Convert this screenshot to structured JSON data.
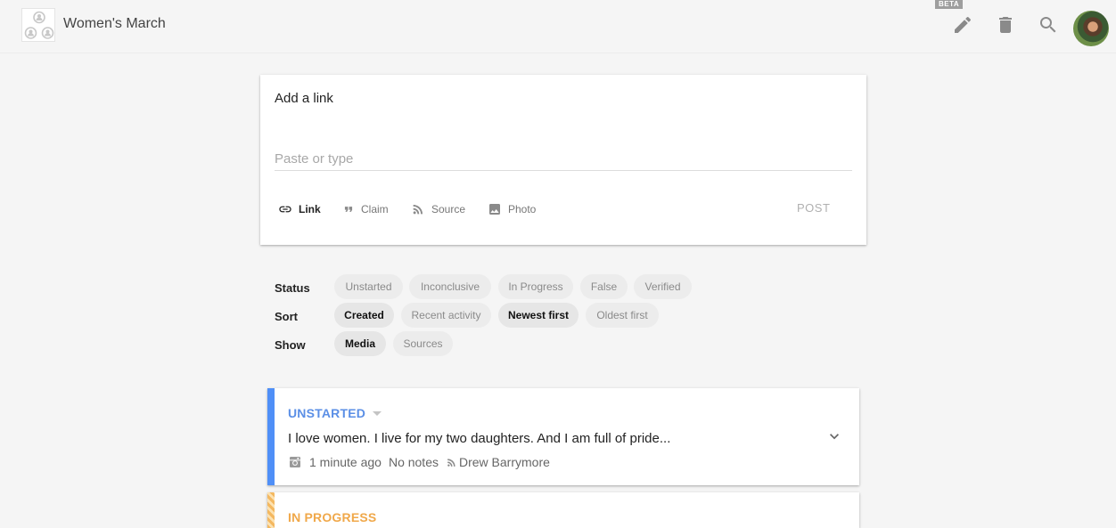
{
  "header": {
    "team_name": "Women's March",
    "beta_label": "BETA",
    "icons": [
      "pencil-icon",
      "trash-icon",
      "search-icon"
    ]
  },
  "add_link": {
    "title": "Add a link",
    "placeholder": "Paste or type",
    "value": "",
    "tools": [
      {
        "label": "Link",
        "icon": "link-icon",
        "active": true
      },
      {
        "label": "Claim",
        "icon": "quote-icon",
        "active": false
      },
      {
        "label": "Source",
        "icon": "rss-icon",
        "active": false
      },
      {
        "label": "Photo",
        "icon": "image-icon",
        "active": false
      }
    ],
    "post_label": "POST"
  },
  "filters": {
    "status": {
      "label": "Status",
      "options": [
        "Unstarted",
        "Inconclusive",
        "In Progress",
        "False",
        "Verified"
      ],
      "selected": []
    },
    "sort": {
      "label": "Sort",
      "options": [
        "Created",
        "Recent activity",
        "Newest first",
        "Oldest first"
      ],
      "selected": [
        "Created",
        "Newest first"
      ]
    },
    "show": {
      "label": "Show",
      "options": [
        "Media",
        "Sources"
      ],
      "selected": [
        "Media"
      ]
    }
  },
  "media": [
    {
      "status": "UNSTARTED",
      "status_color": "#5b8fe6",
      "title": "I love women. I live for my two daughters. And I am full of pride...",
      "time": "1 minute ago",
      "notes": "No notes",
      "source": "Drew Barrymore",
      "type_icon": "instagram-icon"
    },
    {
      "status": "IN PROGRESS",
      "status_color": "#f0a84a"
    }
  ],
  "colors": {
    "accent_blue": "#4f8ff7",
    "in_progress": "#f4b860",
    "background": "#f5f5f5"
  }
}
